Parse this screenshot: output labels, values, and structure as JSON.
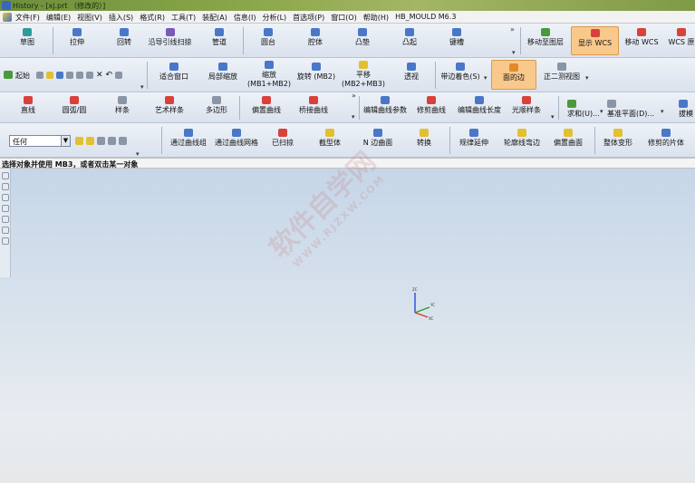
{
  "window": {
    "title": "History - [xj.prt （修改的）]"
  },
  "menu": [
    "文件(F)",
    "编辑(E)",
    "视图(V)",
    "插入(S)",
    "格式(R)",
    "工具(T)",
    "装配(A)",
    "信息(I)",
    "分析(L)",
    "首选项(P)",
    "窗口(O)",
    "帮助(H)",
    "HB_MOULD M6.3"
  ],
  "row1": {
    "sketch": "草图",
    "extrude": "拉伸",
    "revolve": "回转",
    "sweep_along_guide": "沿导引线扫掠",
    "tube": "管道",
    "boss": "圆台",
    "pocket": "腔体",
    "pad": "凸垫",
    "emboss": "凸起",
    "slot": "键槽",
    "move_to_layer": "移动至图层",
    "show_wcs": "显示 WCS",
    "move_wcs": "移动 WCS",
    "wcs_cut": "WCS 原"
  },
  "row2": {
    "start": "起始",
    "fit": "适合窗口",
    "zoom_region": "局部缩放",
    "zoom_line1": "缩放",
    "zoom_line2": "(MB1+MB2)",
    "rotate": "旋转 (MB2)",
    "pan_line1": "平移",
    "pan_line2": "(MB2+MB3)",
    "perspective": "透视",
    "shaded_edges": "带边着色(S)",
    "hidden_edges": "面的边",
    "trimetric": "正二测视图"
  },
  "row3": {
    "line": "直线",
    "arc_circle": "圆弧/圆",
    "spline": "样条",
    "studio_spline": "艺术样条",
    "polygon": "多边形",
    "offset_curve": "偏置曲线",
    "bridge_curve": "桥接曲线",
    "edit_curve_params": "编辑曲线参数",
    "trim_curve": "修剪曲线",
    "edit_curve_length": "编辑曲线长度",
    "smooth_spline": "光顺样条",
    "sum": "求和(U)...",
    "datum_plane": "基准平面(D)...",
    "draft": "拔模"
  },
  "row4": {
    "filter_value": "任何",
    "through_curves": "通过曲线组",
    "through_curve_mesh": "通过曲线网格",
    "swept": "已扫掠",
    "section_body": "截型体",
    "n_sided": "N 边曲面",
    "transform": "转换",
    "law_extension": "规律延伸",
    "profile_flange": "轮廓线弯边",
    "offset_surface": "偏置曲面",
    "global_shaping": "整体变形",
    "trimmed_sheet": "修剪的片体"
  },
  "status": {
    "message": "选择对象并使用 MB3，或者双击某一对象"
  },
  "watermark": {
    "text": "软件自学网",
    "url": "WWW.RJZXW.COM"
  },
  "triad": {
    "labels": [
      "ZC",
      "YC",
      "XC"
    ]
  },
  "colors": {
    "highlight": "#f9c98c",
    "x_axis": "#d83a3a",
    "y_axis": "#2a9a2a",
    "z_axis": "#2a4ad8"
  }
}
